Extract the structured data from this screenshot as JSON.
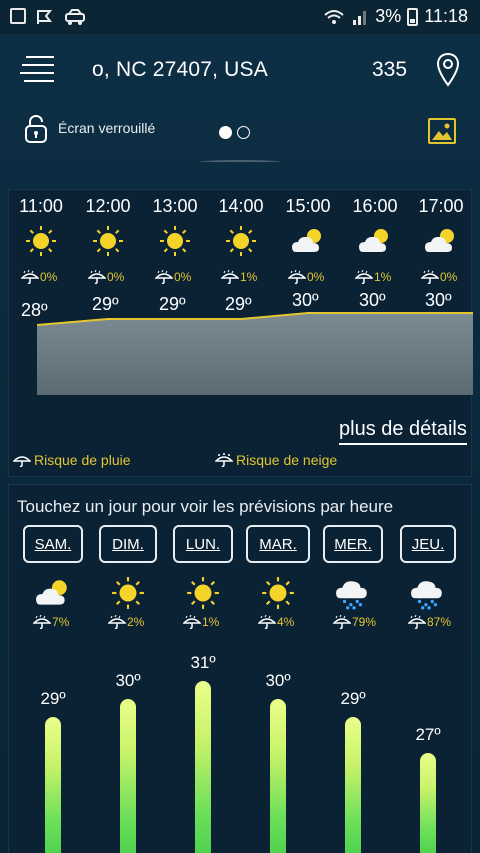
{
  "status_bar": {
    "battery": "3%",
    "time": "11:18"
  },
  "header": {
    "location": "o, NC 27407, USA",
    "number": "335",
    "lock_label": "Écran verrouillé"
  },
  "hourly": {
    "hours": [
      {
        "time": "11:00",
        "icon": "sun-icon",
        "rain": "0%",
        "temp": "28º"
      },
      {
        "time": "12:00",
        "icon": "sun-icon",
        "rain": "0%",
        "temp": "29º"
      },
      {
        "time": "13:00",
        "icon": "sun-icon",
        "rain": "0%",
        "temp": "29º"
      },
      {
        "time": "14:00",
        "icon": "sun-icon",
        "rain": "1%",
        "temp": "29º"
      },
      {
        "time": "15:00",
        "icon": "partly-cloudy-icon",
        "rain": "0%",
        "temp": "30º"
      },
      {
        "time": "16:00",
        "icon": "partly-cloudy-icon",
        "rain": "1%",
        "temp": "30º"
      },
      {
        "time": "17:00",
        "icon": "partly-cloudy-icon",
        "rain": "0%",
        "temp": "30º"
      }
    ],
    "details_link": "plus de détails",
    "legend_rain": "Risque de pluie",
    "legend_snow": "Risque de neige"
  },
  "daily": {
    "instruction": "Touchez un jour pour voir les prévisions par heure",
    "days": [
      {
        "label": "SAM.",
        "icon": "partly-cloudy-icon",
        "rain": "7%",
        "temp": "29º",
        "temp_value": 29
      },
      {
        "label": "DIM.",
        "icon": "sun-icon",
        "rain": "2%",
        "temp": "30º",
        "temp_value": 30
      },
      {
        "label": "LUN.",
        "icon": "sun-icon",
        "rain": "1%",
        "temp": "31º",
        "temp_value": 31
      },
      {
        "label": "MAR.",
        "icon": "sun-icon",
        "rain": "4%",
        "temp": "30º",
        "temp_value": 30
      },
      {
        "label": "MER.",
        "icon": "rain-cloud-icon",
        "rain": "79%",
        "temp": "29º",
        "temp_value": 29
      },
      {
        "label": "JEU.",
        "icon": "rain-cloud-icon",
        "rain": "87%",
        "temp": "27º",
        "temp_value": 27
      }
    ]
  },
  "colors": {
    "accent_yellow": "#e3c530",
    "background": "#0b2a3d",
    "bar_top": "#eaff8a",
    "bar_bottom": "#4fd24f"
  }
}
